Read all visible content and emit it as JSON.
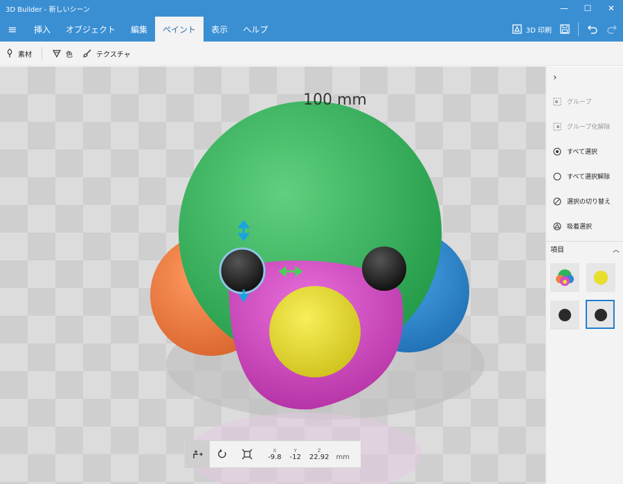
{
  "window": {
    "title": "3D Builder - 新しいシーン",
    "minimize": "—",
    "maximize": "☐",
    "close": "✕"
  },
  "tabs": [
    {
      "label": "挿入"
    },
    {
      "label": "オブジェクト"
    },
    {
      "label": "編集"
    },
    {
      "label": "ペイント"
    },
    {
      "label": "表示"
    },
    {
      "label": "ヘルプ"
    }
  ],
  "active_tab": "ペイント",
  "toolbar_right": {
    "print_label": "3D 印刷"
  },
  "ribbon": {
    "material": "素材",
    "color": "色",
    "texture": "テクスチャ"
  },
  "viewport": {
    "dimension": "100 mm"
  },
  "transform": {
    "x_label": "X",
    "y_label": "Y",
    "z_label": "Z",
    "x": "-9.8",
    "y": "-12",
    "z": "22.92",
    "unit": "mm"
  },
  "side_panel": {
    "group": "グループ",
    "ungroup": "グループ化解除",
    "select_all": "すべて選択",
    "deselect_all": "すべて選択解除",
    "toggle_select": "選択の切り替え",
    "lasso_select": "吸着選択",
    "items_header": "項目"
  },
  "colors": {
    "accent": "#3a8fd3",
    "green": "#2fb35a",
    "orange": "#f07f44",
    "blue": "#2f86d0",
    "magenta": "#d64cc6",
    "yellow": "#e8de2c",
    "black": "#2a2a2a",
    "gizmo_blue": "#1aa3e0",
    "gizmo_green": "#4cd05a"
  }
}
